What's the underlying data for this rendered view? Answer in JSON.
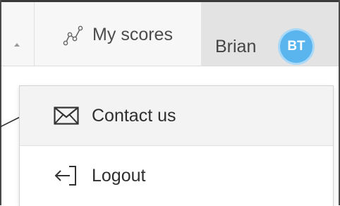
{
  "navbar": {
    "scores_label": "My scores",
    "scores_icon": "chart-line-icon",
    "user_name": "Brian",
    "user_initials": "BT",
    "avatar_color": "#5ab4ee"
  },
  "dropdown": {
    "items": [
      {
        "label": "Contact us",
        "icon": "envelope-icon"
      },
      {
        "label": "Logout",
        "icon": "logout-arrow-icon"
      }
    ]
  }
}
